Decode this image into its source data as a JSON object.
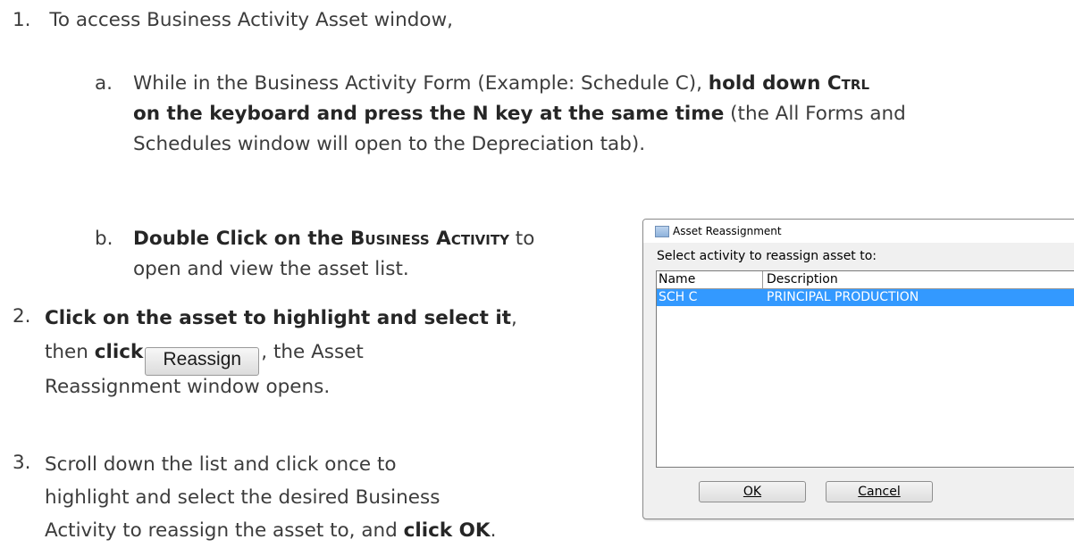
{
  "steps": {
    "s1": {
      "num": "1.",
      "text": "To access Business Activity Asset window,"
    },
    "s1a": {
      "letter": "a.",
      "t1": "While in the Business Activity Form (Example: Schedule C), ",
      "b1": "hold down ",
      "b1sc": "Ctrl",
      "b2": "on the keyboard and press the N key at the same time",
      "t2": " (the All Forms and",
      "t3": "Schedules window will open to the Depreciation tab)."
    },
    "s1b": {
      "letter": "b.",
      "b1": "Double Click on the ",
      "b1sc": "Business Activity",
      "t1": " to",
      "t2": "open and view the asset list."
    },
    "s2": {
      "num": "2.",
      "b1": "Click on the asset to highlight and select it",
      "t1": ",",
      "t2a": "then ",
      "b2": "click",
      "button": "Reassign",
      "t2b": ", the Asset",
      "t3": "Reassignment window opens."
    },
    "s3": {
      "num": "3.",
      "t1": "Scroll down the list and click once to",
      "t2": "highlight and select the desired Business",
      "t3": "Activity to reassign the asset to, and ",
      "b1": "click OK",
      "t4": "."
    }
  },
  "dialog": {
    "title": "Asset Reassignment",
    "prompt": "Select activity to reassign asset to:",
    "columns": [
      "Name",
      "Description"
    ],
    "rows": [
      {
        "name": "SCH C",
        "description": "PRINCIPAL PRODUCTION"
      }
    ],
    "ok_label": "OK",
    "cancel_label": "Cancel"
  }
}
